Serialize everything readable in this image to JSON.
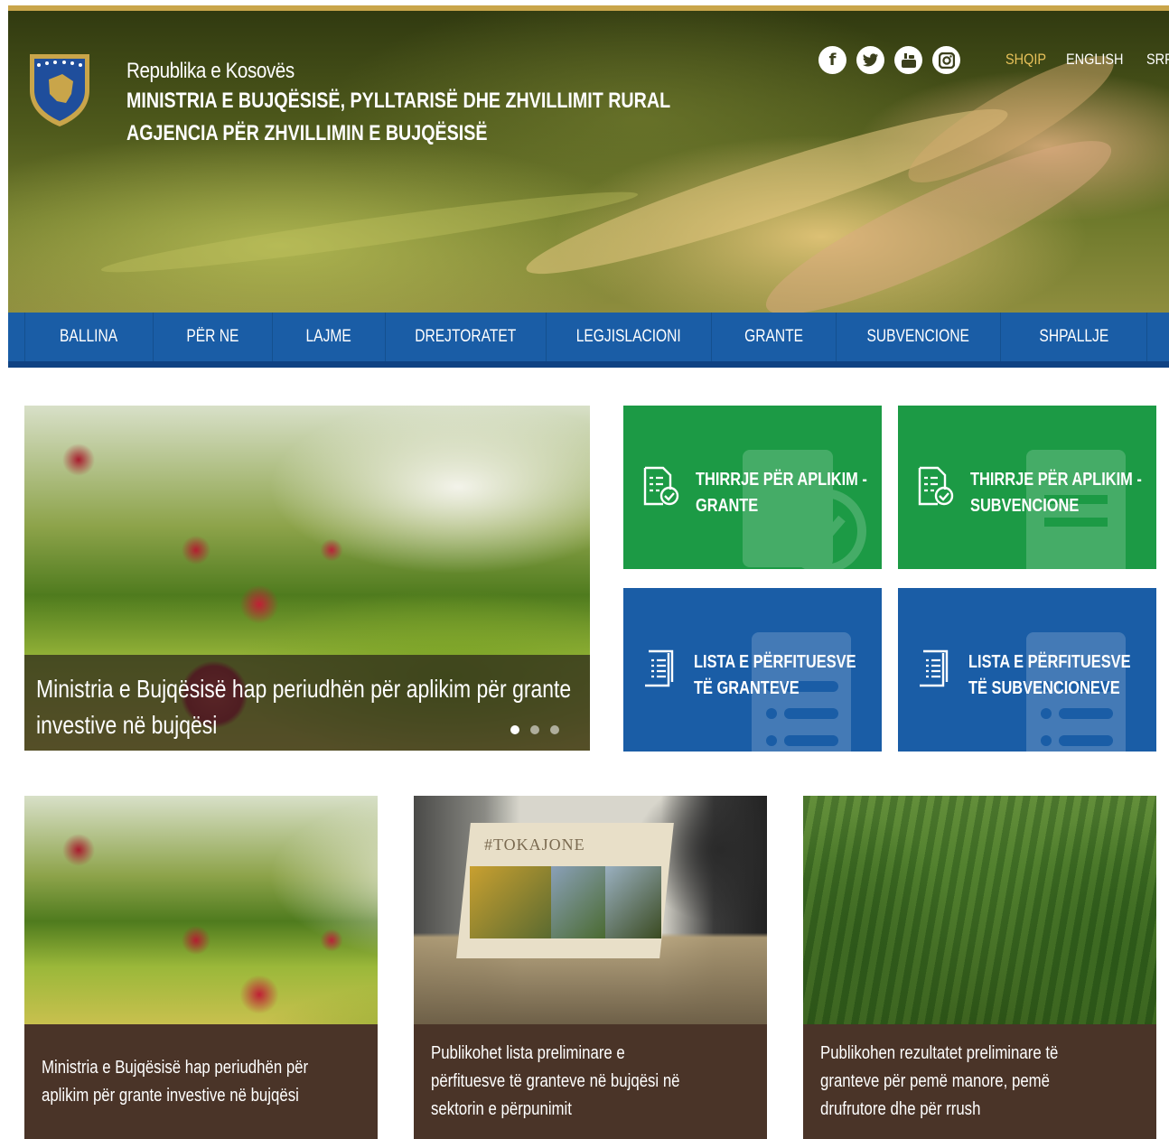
{
  "header": {
    "republic": "Republika e Kosovës",
    "ministry": "MINISTRIA E BUJQËSISË, PYLLTARISË DHE ZHVILLIMIT RURAL",
    "agency": "AGJENCIA PËR ZHVILLIMIN E BUJQËSISË",
    "social_icons": [
      "facebook-icon",
      "twitter-icon",
      "youtube-icon",
      "instagram-icon"
    ],
    "languages": [
      {
        "label": "SHQIP",
        "active": true
      },
      {
        "label": "ENGLISH",
        "active": false
      },
      {
        "label": "SRPSKI",
        "active": false
      }
    ]
  },
  "nav": {
    "items": [
      {
        "label": "BALLINA"
      },
      {
        "label": "PËR NE"
      },
      {
        "label": "LAJME"
      },
      {
        "label": "DREJTORATET"
      },
      {
        "label": "LEGJISLACIONI"
      },
      {
        "label": "GRANTE"
      },
      {
        "label": "SUBVENCIONE"
      },
      {
        "label": "SHPALLJE"
      }
    ]
  },
  "slider": {
    "caption": "Ministria e Bujqësisë hap periudhën për aplikim për grante investive në bujqësi",
    "dots": 3,
    "active_dot": 1
  },
  "tiles": [
    {
      "label": "THIRRJE PËR APLIKIM - GRANTE",
      "color": "#1c9a45",
      "icon": "application-form-icon"
    },
    {
      "label": "THIRRJE PËR APLIKIM - SUBVENCIONE",
      "color": "#1c9a45",
      "icon": "application-form-icon"
    },
    {
      "label": "LISTA E PËRFITUESVE TË GRANTEVE",
      "color": "#1a5da6",
      "icon": "list-document-icon"
    },
    {
      "label": "LISTA E PËRFITUESVE TË SUBVENCIONEVE",
      "color": "#1a5da6",
      "icon": "list-document-icon"
    }
  ],
  "news": [
    {
      "caption": "Ministria e Bujqësisë hap periudhën për aplikim për grante investive në bujqësi"
    },
    {
      "caption": "Publikohet lista preliminare e përfituesve të granteve në bujqësi në sektorin e përpunimit",
      "book_title": "#TOKAJONE"
    },
    {
      "caption": "Publikohen rezultatet preliminare të granteve për pemë manore, pemë drufrutore dhe për rrush"
    }
  ],
  "colors": {
    "gold_accent": "#c9a54a",
    "nav_blue": "#1a5da6",
    "tile_green": "#1c9a45",
    "news_brown": "#4a3428",
    "active_lang": "#e8c25a"
  }
}
